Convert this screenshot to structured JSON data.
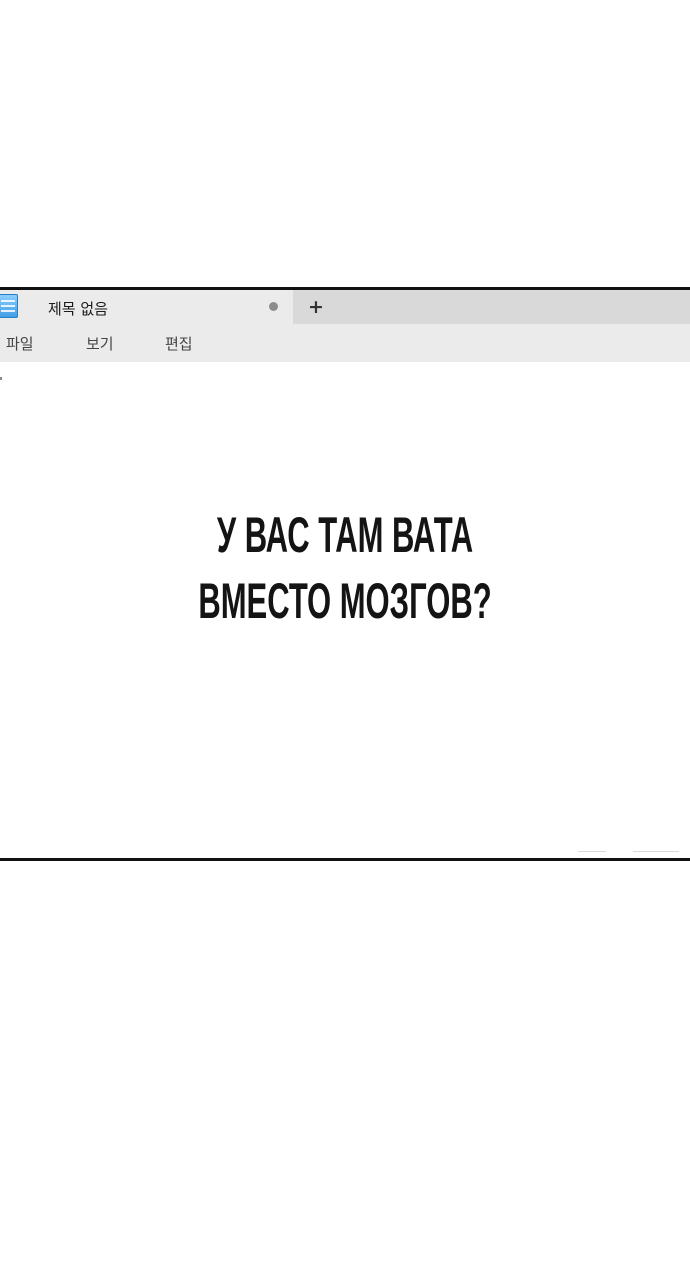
{
  "window": {
    "tab": {
      "title": "제목 없음",
      "unsaved": true,
      "app_icon": "notepad-icon"
    },
    "new_tab_label": "+",
    "menu": {
      "file": "파일",
      "view": "보기",
      "edit": "편집"
    },
    "document": {
      "lines": [
        "У ВАС ТАМ ВАТА",
        "ВМЕСТО МОЗГОВ?"
      ]
    }
  }
}
